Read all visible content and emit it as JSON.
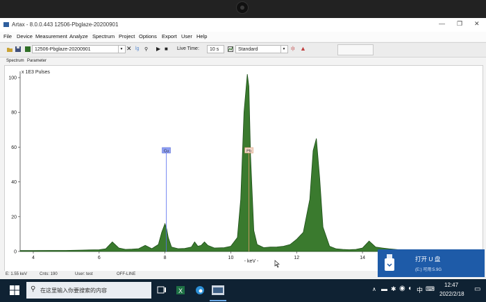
{
  "window": {
    "title": "Artax - 8.0.0.443 12506-Pbglaze-20200901",
    "controls": [
      "—",
      "❐",
      "✕"
    ]
  },
  "menu": [
    "File",
    "Device",
    "Measurement",
    "Analyze",
    "Spectrum",
    "Project",
    "Options",
    "Export",
    "User",
    "Help"
  ],
  "toolbar": {
    "spectrum_name": "12506-Pbglaze-20200901",
    "live_time_label": "Live Time:",
    "live_time_value": "10 s",
    "mode": "Standard"
  },
  "tabs": [
    "Spectrum",
    "Parameter"
  ],
  "chart_data": {
    "type": "line",
    "unit_label": "x 1E3 Pulses",
    "xlabel": "- keV -",
    "xlim": [
      3.6,
      15.2
    ],
    "ylim": [
      0,
      102
    ],
    "xticks": [
      "4",
      "6",
      "8",
      "10",
      "12",
      "14"
    ],
    "yticks": [
      "100",
      "80",
      "60",
      "40",
      "20",
      "0"
    ],
    "element_markers": [
      {
        "label": "Cu",
        "energy": 8.04
      },
      {
        "label": "Pb",
        "energy": 10.55
      }
    ],
    "series": [
      {
        "x": [
          3.6,
          4.0,
          4.5,
          5.0,
          5.5,
          6.0,
          6.2,
          6.4,
          6.6,
          6.8,
          7.0,
          7.2,
          7.4,
          7.6,
          7.8,
          7.9,
          8.0,
          8.05,
          8.1,
          8.2,
          8.4,
          8.6,
          8.8,
          8.9,
          9.0,
          9.1,
          9.2,
          9.3,
          9.5,
          9.8,
          10.0,
          10.2,
          10.3,
          10.4,
          10.5,
          10.55,
          10.6,
          10.7,
          10.8,
          11.0,
          11.2,
          11.4,
          11.6,
          11.8,
          12.0,
          12.2,
          12.4,
          12.5,
          12.6,
          12.7,
          12.8,
          13.0,
          13.2,
          13.4,
          13.6,
          13.8,
          14.0,
          14.2,
          14.4,
          14.6,
          14.8,
          15.0,
          15.2
        ],
        "y": [
          0.5,
          0.5,
          0.6,
          0.6,
          0.8,
          1.0,
          1.5,
          5.5,
          2.0,
          1.2,
          1.3,
          1.6,
          3.5,
          1.6,
          4.0,
          11.0,
          16.0,
          13.0,
          8.0,
          2.5,
          1.6,
          1.7,
          2.5,
          5.5,
          3.0,
          3.5,
          5.5,
          3.5,
          2.0,
          2.2,
          3.0,
          8.0,
          30.0,
          80.0,
          102.0,
          95.0,
          55.0,
          12.0,
          4.0,
          2.2,
          2.5,
          2.6,
          3.0,
          4.0,
          7.0,
          11.0,
          30.0,
          58.0,
          65.0,
          42.0,
          14.0,
          3.0,
          1.5,
          1.2,
          1.0,
          1.2,
          2.0,
          6.0,
          2.5,
          2.0,
          1.5,
          1.2,
          0.8
        ]
      }
    ]
  },
  "status": {
    "energy": "E: 1.55 keV",
    "counts": "Cnts: 190",
    "user": "User: test",
    "state": "OFF-LINE"
  },
  "taskbar": {
    "search_placeholder": "在这里输入你要搜索的内容",
    "time": "12:47",
    "date": "2022/2/18",
    "ime": "中"
  },
  "usb_popup": {
    "title": "打开 U 盘",
    "subtitle": "(E:) 可用:5.9G"
  },
  "colors": {
    "spectrum_fill": "#3a7a2e",
    "spectrum_line": "#1d4f18",
    "marker_line": "#5a6ff0",
    "taskbar": "#0f2233",
    "popup": "#1e5ba8"
  }
}
